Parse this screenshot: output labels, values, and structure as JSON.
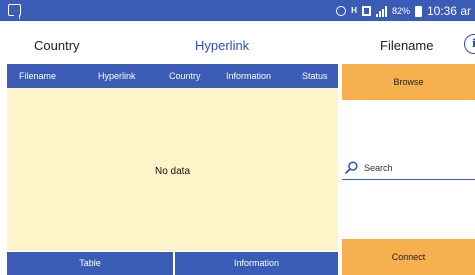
{
  "status_bar": {
    "signal_mark": "H",
    "battery_percent": "82%",
    "time": "10:36 ar",
    "icons": [
      "notification-icon",
      "alarm-icon",
      "screen-icon",
      "signal-icon",
      "battery-icon"
    ]
  },
  "header": {
    "country_label": "Country",
    "hyperlink_label": "Hyperlink",
    "filename_label": "Filename",
    "info_glyph": "i"
  },
  "table": {
    "columns": [
      "Filename",
      "Hyperlink",
      "Country",
      "Information",
      "Status"
    ],
    "empty_text": "No data"
  },
  "bottom_tabs": {
    "table_label": "Table",
    "information_label": "Information"
  },
  "side_panel": {
    "browse_label": "Browse",
    "search_label": "Search",
    "connect_label": "Connect"
  },
  "colors": {
    "primary_blue": "#3a5bb6",
    "accent_orange": "#f6b04e",
    "table_background": "#fdf5c9",
    "link_blue": "#2e4fb3"
  }
}
